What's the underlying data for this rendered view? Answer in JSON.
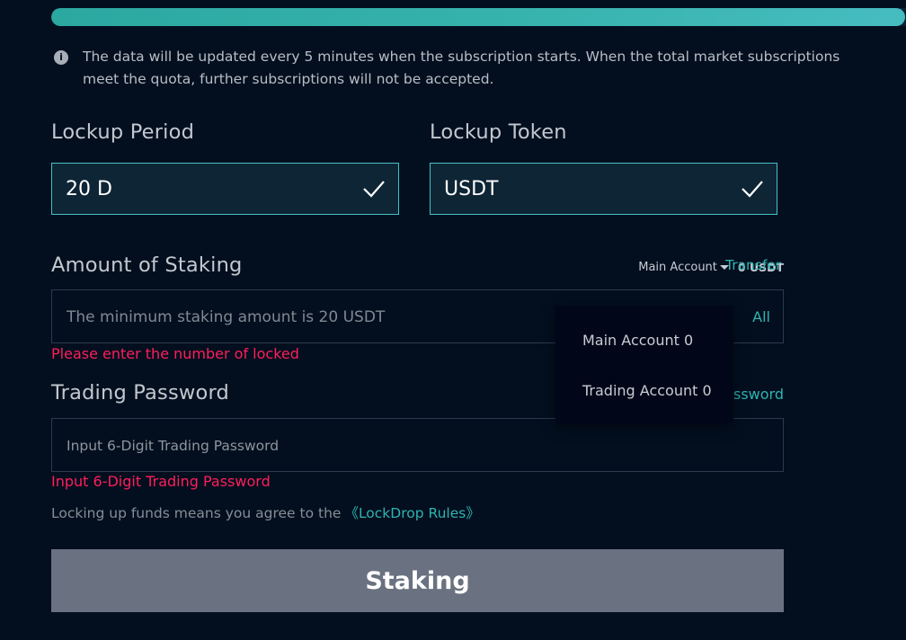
{
  "progress": {
    "fill_fraction": 0.99,
    "color": "#37b3ad"
  },
  "notice": {
    "icon": "info-icon",
    "text": "The data will be updated every 5 minutes when the subscription starts. When the total market subscriptions meet the quota, further subscriptions will not be accepted."
  },
  "lockup_period": {
    "label": "Lockup Period",
    "value": "20 D",
    "icon": "check-icon"
  },
  "lockup_token": {
    "label": "Lockup Token",
    "value": "USDT",
    "icon": "check-icon"
  },
  "amount": {
    "label": "Amount of Staking",
    "account_select": "Main Account",
    "balance": "0 USDT",
    "transfer_label": "Transfer",
    "placeholder": "The minimum staking amount is 20 USDT",
    "value": "",
    "all_label": "All",
    "error": "Please enter the number of locked"
  },
  "account_dropdown": {
    "options": [
      "Main Account 0",
      "Trading Account 0"
    ]
  },
  "password": {
    "label": "Trading Password",
    "forgot_label": "ssword",
    "placeholder": "Input 6-Digit Trading Password",
    "value": "",
    "error": "Input 6-Digit Trading Password"
  },
  "agreement": {
    "text": "Locking up funds means you agree to the",
    "link": "《LockDrop Rules》"
  },
  "submit_label": "Staking",
  "colors": {
    "background": "#030f1f",
    "accent": "#2fb4b0",
    "error": "#ff1e5a",
    "button": "#6a7180"
  }
}
